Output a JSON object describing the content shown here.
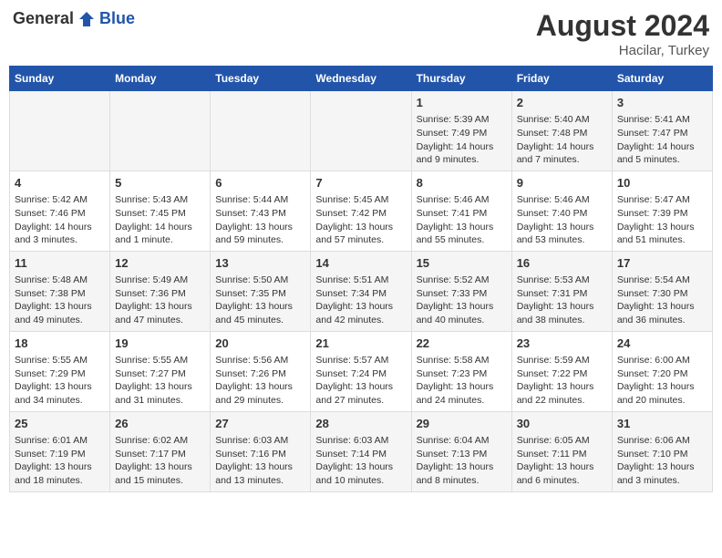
{
  "header": {
    "logo_general": "General",
    "logo_blue": "Blue",
    "month_year": "August 2024",
    "location": "Hacilar, Turkey"
  },
  "days_of_week": [
    "Sunday",
    "Monday",
    "Tuesday",
    "Wednesday",
    "Thursday",
    "Friday",
    "Saturday"
  ],
  "weeks": [
    [
      {
        "day": "",
        "info": ""
      },
      {
        "day": "",
        "info": ""
      },
      {
        "day": "",
        "info": ""
      },
      {
        "day": "",
        "info": ""
      },
      {
        "day": "1",
        "info": "Sunrise: 5:39 AM\nSunset: 7:49 PM\nDaylight: 14 hours\nand 9 minutes."
      },
      {
        "day": "2",
        "info": "Sunrise: 5:40 AM\nSunset: 7:48 PM\nDaylight: 14 hours\nand 7 minutes."
      },
      {
        "day": "3",
        "info": "Sunrise: 5:41 AM\nSunset: 7:47 PM\nDaylight: 14 hours\nand 5 minutes."
      }
    ],
    [
      {
        "day": "4",
        "info": "Sunrise: 5:42 AM\nSunset: 7:46 PM\nDaylight: 14 hours\nand 3 minutes."
      },
      {
        "day": "5",
        "info": "Sunrise: 5:43 AM\nSunset: 7:45 PM\nDaylight: 14 hours\nand 1 minute."
      },
      {
        "day": "6",
        "info": "Sunrise: 5:44 AM\nSunset: 7:43 PM\nDaylight: 13 hours\nand 59 minutes."
      },
      {
        "day": "7",
        "info": "Sunrise: 5:45 AM\nSunset: 7:42 PM\nDaylight: 13 hours\nand 57 minutes."
      },
      {
        "day": "8",
        "info": "Sunrise: 5:46 AM\nSunset: 7:41 PM\nDaylight: 13 hours\nand 55 minutes."
      },
      {
        "day": "9",
        "info": "Sunrise: 5:46 AM\nSunset: 7:40 PM\nDaylight: 13 hours\nand 53 minutes."
      },
      {
        "day": "10",
        "info": "Sunrise: 5:47 AM\nSunset: 7:39 PM\nDaylight: 13 hours\nand 51 minutes."
      }
    ],
    [
      {
        "day": "11",
        "info": "Sunrise: 5:48 AM\nSunset: 7:38 PM\nDaylight: 13 hours\nand 49 minutes."
      },
      {
        "day": "12",
        "info": "Sunrise: 5:49 AM\nSunset: 7:36 PM\nDaylight: 13 hours\nand 47 minutes."
      },
      {
        "day": "13",
        "info": "Sunrise: 5:50 AM\nSunset: 7:35 PM\nDaylight: 13 hours\nand 45 minutes."
      },
      {
        "day": "14",
        "info": "Sunrise: 5:51 AM\nSunset: 7:34 PM\nDaylight: 13 hours\nand 42 minutes."
      },
      {
        "day": "15",
        "info": "Sunrise: 5:52 AM\nSunset: 7:33 PM\nDaylight: 13 hours\nand 40 minutes."
      },
      {
        "day": "16",
        "info": "Sunrise: 5:53 AM\nSunset: 7:31 PM\nDaylight: 13 hours\nand 38 minutes."
      },
      {
        "day": "17",
        "info": "Sunrise: 5:54 AM\nSunset: 7:30 PM\nDaylight: 13 hours\nand 36 minutes."
      }
    ],
    [
      {
        "day": "18",
        "info": "Sunrise: 5:55 AM\nSunset: 7:29 PM\nDaylight: 13 hours\nand 34 minutes."
      },
      {
        "day": "19",
        "info": "Sunrise: 5:55 AM\nSunset: 7:27 PM\nDaylight: 13 hours\nand 31 minutes."
      },
      {
        "day": "20",
        "info": "Sunrise: 5:56 AM\nSunset: 7:26 PM\nDaylight: 13 hours\nand 29 minutes."
      },
      {
        "day": "21",
        "info": "Sunrise: 5:57 AM\nSunset: 7:24 PM\nDaylight: 13 hours\nand 27 minutes."
      },
      {
        "day": "22",
        "info": "Sunrise: 5:58 AM\nSunset: 7:23 PM\nDaylight: 13 hours\nand 24 minutes."
      },
      {
        "day": "23",
        "info": "Sunrise: 5:59 AM\nSunset: 7:22 PM\nDaylight: 13 hours\nand 22 minutes."
      },
      {
        "day": "24",
        "info": "Sunrise: 6:00 AM\nSunset: 7:20 PM\nDaylight: 13 hours\nand 20 minutes."
      }
    ],
    [
      {
        "day": "25",
        "info": "Sunrise: 6:01 AM\nSunset: 7:19 PM\nDaylight: 13 hours\nand 18 minutes."
      },
      {
        "day": "26",
        "info": "Sunrise: 6:02 AM\nSunset: 7:17 PM\nDaylight: 13 hours\nand 15 minutes."
      },
      {
        "day": "27",
        "info": "Sunrise: 6:03 AM\nSunset: 7:16 PM\nDaylight: 13 hours\nand 13 minutes."
      },
      {
        "day": "28",
        "info": "Sunrise: 6:03 AM\nSunset: 7:14 PM\nDaylight: 13 hours\nand 10 minutes."
      },
      {
        "day": "29",
        "info": "Sunrise: 6:04 AM\nSunset: 7:13 PM\nDaylight: 13 hours\nand 8 minutes."
      },
      {
        "day": "30",
        "info": "Sunrise: 6:05 AM\nSunset: 7:11 PM\nDaylight: 13 hours\nand 6 minutes."
      },
      {
        "day": "31",
        "info": "Sunrise: 6:06 AM\nSunset: 7:10 PM\nDaylight: 13 hours\nand 3 minutes."
      }
    ]
  ]
}
